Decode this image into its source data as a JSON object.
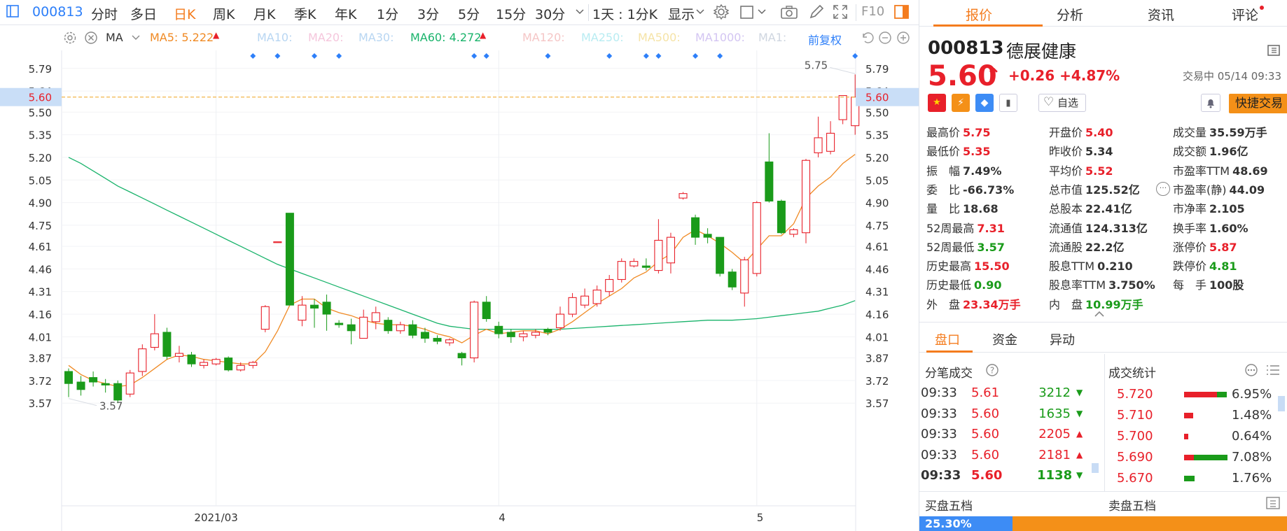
{
  "toolbar": {
    "code": "000813",
    "periods": [
      "分时",
      "多日",
      "日K",
      "周K",
      "月K",
      "季K",
      "年K",
      "1分",
      "3分",
      "5分",
      "15分",
      "30分"
    ],
    "active_period": "日K",
    "range_label": "1天 : 1分K",
    "display_label": "显示",
    "f10_label": "F10"
  },
  "indicator_bar": {
    "ma_label": "MA",
    "ma5": "MA5: 5.222",
    "ma10": "MA10:",
    "ma20": "MA20:",
    "ma30": "MA30:",
    "ma60": "MA60: 4.272",
    "ma120": "MA120:",
    "ma250": "MA250:",
    "ma500": "MA500:",
    "ma1000": "MA1000:",
    "ma1": "MA1:",
    "adjust_label": "前复权",
    "colors": {
      "ma5": "#f08a24",
      "ma60": "#19b36b",
      "faded": "#b8d6f2"
    }
  },
  "chart_data": {
    "type": "candlestick",
    "y_ticks": [
      "5.79",
      "5.64",
      "5.50",
      "5.35",
      "5.20",
      "5.05",
      "4.90",
      "4.75",
      "4.61",
      "4.46",
      "4.31",
      "4.16",
      "4.01",
      "3.87",
      "3.72",
      "3.57"
    ],
    "ylim": [
      3.52,
      5.84
    ],
    "x_labels": [
      {
        "index": 12,
        "label": "2021/03"
      },
      {
        "index": 35,
        "label": "4"
      },
      {
        "index": 56,
        "label": "5"
      }
    ],
    "current_price_label": "5.60",
    "current_price": 5.6,
    "high_annotation": "5.75",
    "low_annotation": "3.57",
    "candles": [
      [
        3.78,
        3.7,
        3.8,
        3.61
      ],
      [
        3.71,
        3.66,
        3.75,
        3.62
      ],
      [
        3.74,
        3.71,
        3.78,
        3.68
      ],
      [
        3.7,
        3.69,
        3.73,
        3.64
      ],
      [
        3.7,
        3.59,
        3.72,
        3.57
      ],
      [
        3.63,
        3.77,
        3.79,
        3.61
      ],
      [
        3.78,
        3.93,
        3.96,
        3.75
      ],
      [
        3.94,
        4.03,
        4.16,
        3.92
      ],
      [
        4.04,
        3.88,
        4.07,
        3.86
      ],
      [
        3.88,
        3.9,
        3.95,
        3.84
      ],
      [
        3.89,
        3.83,
        3.91,
        3.81
      ],
      [
        3.82,
        3.84,
        3.86,
        3.8
      ],
      [
        3.83,
        3.86,
        3.87,
        3.82
      ],
      [
        3.87,
        3.79,
        3.88,
        3.78
      ],
      [
        3.79,
        3.82,
        3.84,
        3.78
      ],
      [
        3.82,
        3.84,
        3.85,
        3.8
      ],
      [
        4.06,
        4.21,
        4.22,
        4.04
      ],
      [
        4.64,
        4.64,
        4.64,
        4.64
      ],
      [
        4.83,
        4.22,
        4.83,
        4.22
      ],
      [
        4.12,
        4.22,
        4.28,
        4.08
      ],
      [
        4.22,
        4.2,
        4.26,
        4.07
      ],
      [
        4.24,
        4.16,
        4.29,
        4.05
      ],
      [
        4.1,
        4.09,
        4.12,
        4.07
      ],
      [
        4.09,
        4.05,
        4.13,
        3.96
      ],
      [
        4.0,
        4.14,
        4.19,
        4.0
      ],
      [
        4.11,
        4.17,
        4.21,
        4.06
      ],
      [
        4.12,
        4.05,
        4.14,
        4.03
      ],
      [
        4.05,
        4.09,
        4.11,
        4.03
      ],
      [
        4.09,
        4.02,
        4.12,
        4.0
      ],
      [
        4.04,
        4.0,
        4.07,
        3.97
      ],
      [
        4.0,
        3.98,
        4.02,
        3.96
      ],
      [
        3.97,
        3.99,
        4.0,
        3.95
      ],
      [
        3.9,
        3.87,
        3.91,
        3.82
      ],
      [
        3.87,
        4.24,
        4.25,
        3.84
      ],
      [
        4.24,
        4.13,
        4.28,
        4.11
      ],
      [
        4.08,
        4.03,
        4.11,
        4.0
      ],
      [
        4.04,
        4.01,
        4.06,
        3.97
      ],
      [
        4.01,
        4.03,
        4.05,
        3.98
      ],
      [
        4.02,
        4.04,
        4.06,
        4.0
      ],
      [
        4.06,
        4.04,
        4.07,
        4.02
      ],
      [
        4.07,
        4.16,
        4.21,
        4.05
      ],
      [
        4.16,
        4.27,
        4.3,
        4.14
      ],
      [
        4.22,
        4.28,
        4.33,
        4.2
      ],
      [
        4.23,
        4.32,
        4.35,
        4.21
      ],
      [
        4.31,
        4.39,
        4.42,
        4.28
      ],
      [
        4.39,
        4.51,
        4.53,
        4.37
      ],
      [
        4.48,
        4.51,
        4.53,
        4.47
      ],
      [
        4.48,
        4.47,
        4.53,
        4.45
      ],
      [
        4.45,
        4.65,
        4.79,
        4.43
      ],
      [
        4.5,
        4.67,
        4.7,
        4.43
      ],
      [
        4.93,
        4.96,
        4.97,
        4.92
      ],
      [
        4.8,
        4.67,
        4.82,
        4.62
      ],
      [
        4.69,
        4.67,
        4.73,
        4.63
      ],
      [
        4.67,
        4.43,
        4.67,
        4.41
      ],
      [
        4.44,
        4.34,
        4.46,
        4.32
      ],
      [
        4.3,
        4.52,
        4.54,
        4.21
      ],
      [
        4.43,
        4.9,
        4.91,
        4.41
      ],
      [
        5.17,
        4.91,
        5.36,
        4.9
      ],
      [
        4.91,
        4.7,
        4.92,
        4.69
      ],
      [
        4.69,
        4.72,
        4.73,
        4.67
      ],
      [
        4.7,
        5.18,
        5.19,
        4.63
      ],
      [
        5.23,
        5.33,
        5.47,
        5.2
      ],
      [
        5.24,
        5.36,
        5.44,
        5.22
      ],
      [
        5.45,
        5.61,
        5.61,
        5.42
      ],
      [
        5.41,
        5.6,
        5.75,
        5.35
      ]
    ],
    "ma5": [
      3.82,
      3.76,
      3.72,
      3.7,
      3.68,
      3.69,
      3.74,
      3.8,
      3.86,
      3.89,
      3.88,
      3.86,
      3.85,
      3.84,
      3.83,
      3.83,
      3.91,
      4.05,
      4.22,
      4.26,
      4.26,
      4.2,
      4.17,
      4.15,
      4.12,
      4.1,
      4.09,
      4.09,
      4.08,
      4.06,
      4.03,
      4.01,
      3.97,
      4.02,
      4.06,
      4.03,
      4.04,
      4.05,
      4.05,
      4.03,
      4.06,
      4.11,
      4.17,
      4.23,
      4.28,
      4.33,
      4.4,
      4.44,
      4.51,
      4.56,
      4.67,
      4.72,
      4.68,
      4.63,
      4.57,
      4.5,
      4.59,
      4.68,
      4.68,
      4.76,
      4.93,
      5.01,
      5.07,
      5.16,
      5.22
    ],
    "ma60_start_index": 0,
    "ma60": [
      5.2,
      5.16,
      5.11,
      5.06,
      5.01,
      4.97,
      4.93,
      4.89,
      4.85,
      4.81,
      4.77,
      4.73,
      4.69,
      4.65,
      4.61,
      4.57,
      4.53,
      4.49,
      4.46,
      4.43,
      4.4,
      4.37,
      4.34,
      4.31,
      4.28,
      4.25,
      4.22,
      4.19,
      4.16,
      4.13,
      4.1,
      4.08,
      4.07,
      4.06,
      4.06,
      4.06,
      4.06,
      4.06,
      4.06,
      4.06,
      4.06,
      4.065,
      4.07,
      4.075,
      4.08,
      4.085,
      4.09,
      4.095,
      4.1,
      4.105,
      4.11,
      4.115,
      4.12,
      4.12,
      4.12,
      4.125,
      4.13,
      4.14,
      4.15,
      4.16,
      4.17,
      4.18,
      4.2,
      4.22,
      4.25
    ],
    "event_markers": [
      15,
      17,
      20,
      22,
      33,
      34,
      39,
      44,
      47,
      48,
      51,
      53,
      64
    ],
    "colors": {
      "up": "#e8202a",
      "down": "#1a9b1a",
      "ma5": "#f08a24",
      "ma60": "#19b36b",
      "price_line": "#f2b54a",
      "marker": "#2d7ff9"
    }
  },
  "quote": {
    "code": "000813",
    "name": "德展健康",
    "price": "5.60",
    "change": "+0.26",
    "change_pct": "+4.87%",
    "status": "交易中 05/14 09:33",
    "watch_label": "自选",
    "trade_label": "快捷交易"
  },
  "stats": {
    "col1": [
      {
        "label": "最高价",
        "value": "5.75",
        "color": "red"
      },
      {
        "label": "最低价",
        "value": "5.35",
        "color": "red"
      },
      {
        "label": "振　幅",
        "value": "7.49%",
        "color": "plain"
      },
      {
        "label": "委　比",
        "value": "-66.73%",
        "color": "plain"
      },
      {
        "label": "量　比",
        "value": "18.68",
        "color": "plain"
      },
      {
        "label": "52周最高",
        "value": "7.31",
        "color": "red"
      },
      {
        "label": "52周最低",
        "value": "3.57",
        "color": "green"
      },
      {
        "label": "历史最高",
        "value": "15.50",
        "color": "red"
      },
      {
        "label": "历史最低",
        "value": "0.90",
        "color": "green"
      },
      {
        "label": "外　盘",
        "value": "23.34万手",
        "color": "red"
      }
    ],
    "col2": [
      {
        "label": "开盘价",
        "value": "5.40",
        "color": "red"
      },
      {
        "label": "昨收价",
        "value": "5.34",
        "color": "plain"
      },
      {
        "label": "平均价",
        "value": "5.52",
        "color": "red"
      },
      {
        "label": "总市值",
        "value": "125.52亿",
        "color": "plain"
      },
      {
        "label": "总股本",
        "value": "22.41亿",
        "color": "plain"
      },
      {
        "label": "流通值",
        "value": "124.313亿",
        "color": "plain"
      },
      {
        "label": "流通股",
        "value": "22.2亿",
        "color": "plain"
      },
      {
        "label": "股息TTM",
        "value": "0.210",
        "color": "plain"
      },
      {
        "label": "股息率TTM",
        "value": "3.750%",
        "color": "plain"
      },
      {
        "label": "内　盘",
        "value": "10.99万手",
        "color": "green"
      }
    ],
    "col3": [
      {
        "label": "成交量",
        "value": "35.59万手",
        "color": "plain"
      },
      {
        "label": "成交额",
        "value": "1.96亿",
        "color": "plain"
      },
      {
        "label": "市盈率TTM",
        "value": "48.69",
        "color": "plain"
      },
      {
        "label": "市盈率(静)",
        "value": "44.09",
        "color": "plain"
      },
      {
        "label": "市净率",
        "value": "2.105",
        "color": "plain"
      },
      {
        "label": "换手率",
        "value": "1.60%",
        "color": "plain"
      },
      {
        "label": "涨停价",
        "value": "5.87",
        "color": "red"
      },
      {
        "label": "跌停价",
        "value": "4.81",
        "color": "green"
      },
      {
        "label": "每　手",
        "value": "100股",
        "color": "plain"
      }
    ]
  },
  "subtabs": [
    "盘口",
    "资金",
    "异动"
  ],
  "ticks": {
    "title": "分笔成交",
    "rows": [
      {
        "time": "09:33",
        "price": "5.61",
        "vol": "3212",
        "dir": "down"
      },
      {
        "time": "09:33",
        "price": "5.60",
        "vol": "1635",
        "dir": "down"
      },
      {
        "time": "09:33",
        "price": "5.60",
        "vol": "2205",
        "dir": "up"
      },
      {
        "time": "09:33",
        "price": "5.60",
        "vol": "2181",
        "dir": "up"
      },
      {
        "time": "09:33",
        "price": "5.60",
        "vol": "1138",
        "dir": "down"
      }
    ]
  },
  "trade_stats": {
    "title": "成交统计",
    "rows": [
      {
        "price": "5.720",
        "pct": "6.95%",
        "pct_value": 6.95,
        "buy_share": 0.78
      },
      {
        "price": "5.710",
        "pct": "1.48%",
        "pct_value": 1.48,
        "buy_share": 1.0
      },
      {
        "price": "5.700",
        "pct": "0.64%",
        "pct_value": 0.64,
        "buy_share": 1.0
      },
      {
        "price": "5.690",
        "pct": "7.08%",
        "pct_value": 7.08,
        "buy_share": 0.22
      },
      {
        "price": "5.670",
        "pct": "1.76%",
        "pct_value": 1.76,
        "buy_share": 0.0
      }
    ]
  },
  "order_book": {
    "buy_title": "买盘五档",
    "sell_title": "卖盘五档",
    "buy_ratio": "25.30%",
    "buy_ratio_value": 25.3
  },
  "tabs": [
    "报价",
    "分析",
    "资讯",
    "评论"
  ]
}
